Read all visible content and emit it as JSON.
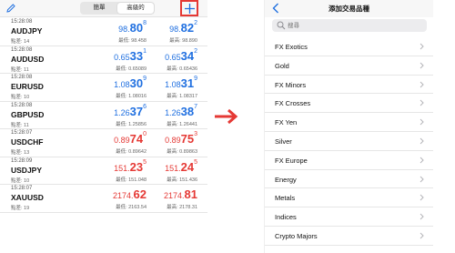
{
  "left": {
    "segment": {
      "simple": "簡單",
      "advanced": "高級的"
    },
    "quotes": [
      {
        "time": "15:28:08",
        "symbol": "AUDJPY",
        "spread": "點差: 14",
        "bid_main": "98.",
        "bid_big": "80",
        "bid_sup": "8",
        "ask_main": "98.",
        "ask_big": "82",
        "ask_sup": "2",
        "low": "最低: 98.458",
        "high": "最高: 98.890",
        "color": "#1f6fe0"
      },
      {
        "time": "15:28:08",
        "symbol": "AUDUSD",
        "spread": "點差: 11",
        "bid_main": "0.65",
        "bid_big": "33",
        "bid_sup": "1",
        "ask_main": "0.65",
        "ask_big": "34",
        "ask_sup": "2",
        "low": "最低: 0.65089",
        "high": "最高: 0.65436",
        "color": "#1f6fe0"
      },
      {
        "time": "15:28:08",
        "symbol": "EURUSD",
        "spread": "點差: 10",
        "bid_main": "1.08",
        "bid_big": "30",
        "bid_sup": "9",
        "ask_main": "1.08",
        "ask_big": "31",
        "ask_sup": "9",
        "low": "最低: 1.08016",
        "high": "最高: 1.08317",
        "color": "#1f6fe0"
      },
      {
        "time": "15:28:08",
        "symbol": "GBPUSD",
        "spread": "點差: 11",
        "bid_main": "1.26",
        "bid_big": "37",
        "bid_sup": "6",
        "ask_main": "1.26",
        "ask_big": "38",
        "ask_sup": "7",
        "low": "最低: 1.25856",
        "high": "最高: 1.26441",
        "color": "#1f6fe0"
      },
      {
        "time": "15:28:07",
        "symbol": "USDCHF",
        "spread": "點差: 13",
        "bid_main": "0.89",
        "bid_big": "74",
        "bid_sup": "0",
        "ask_main": "0.89",
        "ask_big": "75",
        "ask_sup": "3",
        "low": "最低: 0.89642",
        "high": "最高: 0.89863",
        "color": "#e53935"
      },
      {
        "time": "15:28:09",
        "symbol": "USDJPY",
        "spread": "點差: 10",
        "bid_main": "151.",
        "bid_big": "23",
        "bid_sup": "5",
        "ask_main": "151.",
        "ask_big": "24",
        "ask_sup": "5",
        "low": "最低: 151.048",
        "high": "最高: 151.436",
        "color": "#e53935"
      },
      {
        "time": "15:28:07",
        "symbol": "XAUUSD",
        "spread": "點差: 19",
        "bid_main": "2174.",
        "bid_big": "62",
        "bid_sup": "",
        "ask_main": "2174.",
        "ask_big": "81",
        "ask_sup": "",
        "low": "最低: 2163.54",
        "high": "最高: 2178.31",
        "color": "#e53935"
      }
    ]
  },
  "right": {
    "title": "添加交易品種",
    "search_placeholder": "搜尋",
    "categories": [
      "FX Exotics",
      "Gold",
      "FX Minors",
      "FX Crosses",
      "FX Yen",
      "Silver",
      "FX Europe",
      "Energy",
      "Metals",
      "Indices",
      "Crypto Majors"
    ]
  },
  "colors": {
    "up": "#1f6fe0",
    "down": "#e53935",
    "highlight": "#e53935"
  },
  "icons": {
    "edit": "pencil-icon",
    "add": "plus-icon",
    "back": "back-chevron-icon",
    "search": "search-icon",
    "transition": "arrow-right-icon"
  }
}
